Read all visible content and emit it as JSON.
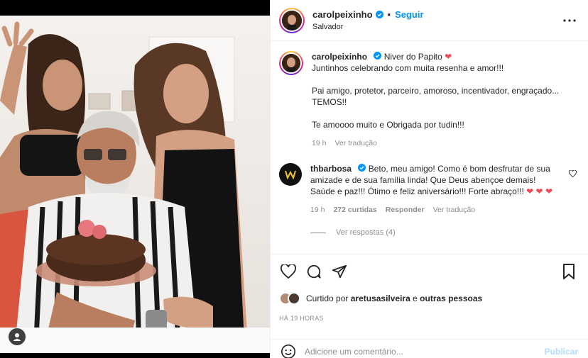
{
  "post": {
    "username": "carolpeixinho",
    "follow_label": "Seguir",
    "location": "Salvador",
    "dot": "•",
    "more_label": "•••"
  },
  "caption": {
    "username": "carolpeixinho",
    "text_line1": "Niver do Papito",
    "line2": "Juntinhos celebrando com muita resenha e amor!!!",
    "line3": "Pai amigo, protetor, parceiro, amoroso, incentivador, engraçado... TEMOS!!",
    "line4": "Te amoooo muito e Obrigada por tudin!!!",
    "time": "19 h",
    "translate": "Ver tradução"
  },
  "comment": {
    "username": "thbarbosa",
    "text": "Beto, meu amigo! Como é bom desfrutar de sua amizade e de sua família linda! Que Deus abençoe demais! Saúde e paz!!! Ótimo e feliz aniversário!!! Forte abraço!!!",
    "hearts": "❤ ❤",
    "heart_extra": "❤",
    "time": "19 h",
    "likes": "272 curtidas",
    "reply": "Responder",
    "translate": "Ver tradução",
    "view_replies": "Ver respostas (4)"
  },
  "likes": {
    "prefix": "Curtido por",
    "user": "aretusasilveira",
    "middle": "e",
    "others": "outras pessoas"
  },
  "timestamp": "HÁ 19 HORAS",
  "composer": {
    "placeholder": "Adicione um comentário...",
    "publish": "Publicar"
  },
  "icons": {
    "heart": "heart-icon",
    "comment": "comment-icon",
    "share": "paper-plane-icon",
    "save": "bookmark-icon",
    "emoji": "emoji-icon",
    "user_tag": "user-tag-icon"
  },
  "colors": {
    "link": "#0095f6",
    "heart": "#ed4956",
    "muted": "#8e8e8e",
    "publish_disabled": "#b3dbff"
  }
}
